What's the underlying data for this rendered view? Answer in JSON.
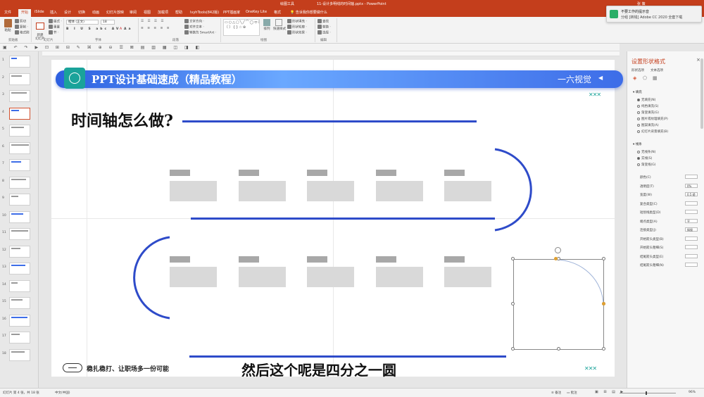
{
  "window": {
    "title": "11-设计多明线的时间轴.pptx  -  PowerPoint",
    "context_tab_group": "绘图工具",
    "user": "张 策"
  },
  "tabs": [
    "文件",
    "开始",
    "iSlide",
    "插入",
    "设计",
    "切换",
    "动画",
    "幻灯片放映",
    "审阅",
    "视图",
    "加载项",
    "帮助",
    "lvyhTools(842版)",
    "PPT插画家",
    "OneKey Lite",
    "格式",
    "告诉我你想要做什么"
  ],
  "active_tab": "开始",
  "ribbon": {
    "clipboard": {
      "paste": "粘贴",
      "cut": "剪切",
      "copy": "复制 ·",
      "format_painter": "格式刷",
      "group": "剪贴板"
    },
    "slides": {
      "new_slide": "新建\n幻灯片",
      "layout": "版式 ·",
      "reset": "重置",
      "section": "节 ·",
      "group": "幻灯片"
    },
    "font": {
      "name": "楷体 (正文)",
      "size": "18",
      "group": "字体"
    },
    "paragraph": {
      "text_direction": "文字方向 ·",
      "align_text": "对齐文本 ·",
      "smartart": "转换为 SmartArt ·",
      "group": "段落"
    },
    "drawing": {
      "arrange": "排列",
      "quick_styles": "快速样式",
      "fill": "形状填充 ·",
      "outline": "形状轮廓 ·",
      "effects": "形状效果 ·",
      "group": "绘图"
    },
    "editing": {
      "find": "查找",
      "replace": "替换 ·",
      "select": "选择 ·",
      "group": "编辑"
    }
  },
  "toast": {
    "title": "不要工作的提示音",
    "body": "分组 [转钱] Adobe CC 2020 全套下载"
  },
  "thumbnails": [
    "1",
    "2",
    "3",
    "4",
    "5",
    "6",
    "7",
    "8",
    "9",
    "10",
    "11",
    "12",
    "13",
    "14",
    "15",
    "16",
    "17",
    "18"
  ],
  "selected_thumbnail": "4",
  "slide": {
    "header_title": "PPT设计基础速成（精品教程）",
    "header_brand": "一六视觉",
    "brand_arrow": "◀",
    "dots_top": "✕✕✕",
    "heading": "时间轴怎么做?",
    "footer_text": "稳扎稳打、让职场多一份可能",
    "dots_bottom": "✕✕✕"
  },
  "subtitle": "然后这个呢是四分之一圆",
  "format_pane": {
    "title": "设置形状格式",
    "tab_shape": "形状选项",
    "tab_text": "文本选项",
    "fill_section": "填充",
    "fill_options": [
      "无填充(N)",
      "纯色填充(S)",
      "渐变填充(G)",
      "图片或纹理填充(P)",
      "图案填充(A)",
      "幻灯片背景填充(B)"
    ],
    "fill_selected": "无填充(N)",
    "line_section": "线条",
    "line_options": [
      "无线条(N)",
      "实线(S)",
      "渐变线(G)"
    ],
    "line_selected": "实线(S)",
    "properties": [
      {
        "label": "颜色(C)",
        "value": ""
      },
      {
        "label": "透明度(T)",
        "value": "0%"
      },
      {
        "label": "宽度(W)",
        "value": "0.5 磅"
      },
      {
        "label": "复合类型(C)",
        "value": ""
      },
      {
        "label": "短划线类型(D)",
        "value": ""
      },
      {
        "label": "端点类型(A)",
        "value": "平"
      },
      {
        "label": "连接类型(J)",
        "value": "斜接"
      },
      {
        "label": "开始箭头类型(B)",
        "value": ""
      },
      {
        "label": "开始箭头粗细(S)",
        "value": ""
      },
      {
        "label": "结尾箭头类型(E)",
        "value": ""
      },
      {
        "label": "结尾箭头粗细(N)",
        "value": ""
      }
    ]
  },
  "status": {
    "slide_info": "幻灯片 第 4 张，共 18 张",
    "language": "中文(中国)",
    "notes": "备注",
    "comments": "批注",
    "zoom": "96%"
  },
  "colors": {
    "accent_ppt": "#c43e1c",
    "timeline_blue": "#2e4bc9",
    "header_teal": "#1aa39a"
  }
}
